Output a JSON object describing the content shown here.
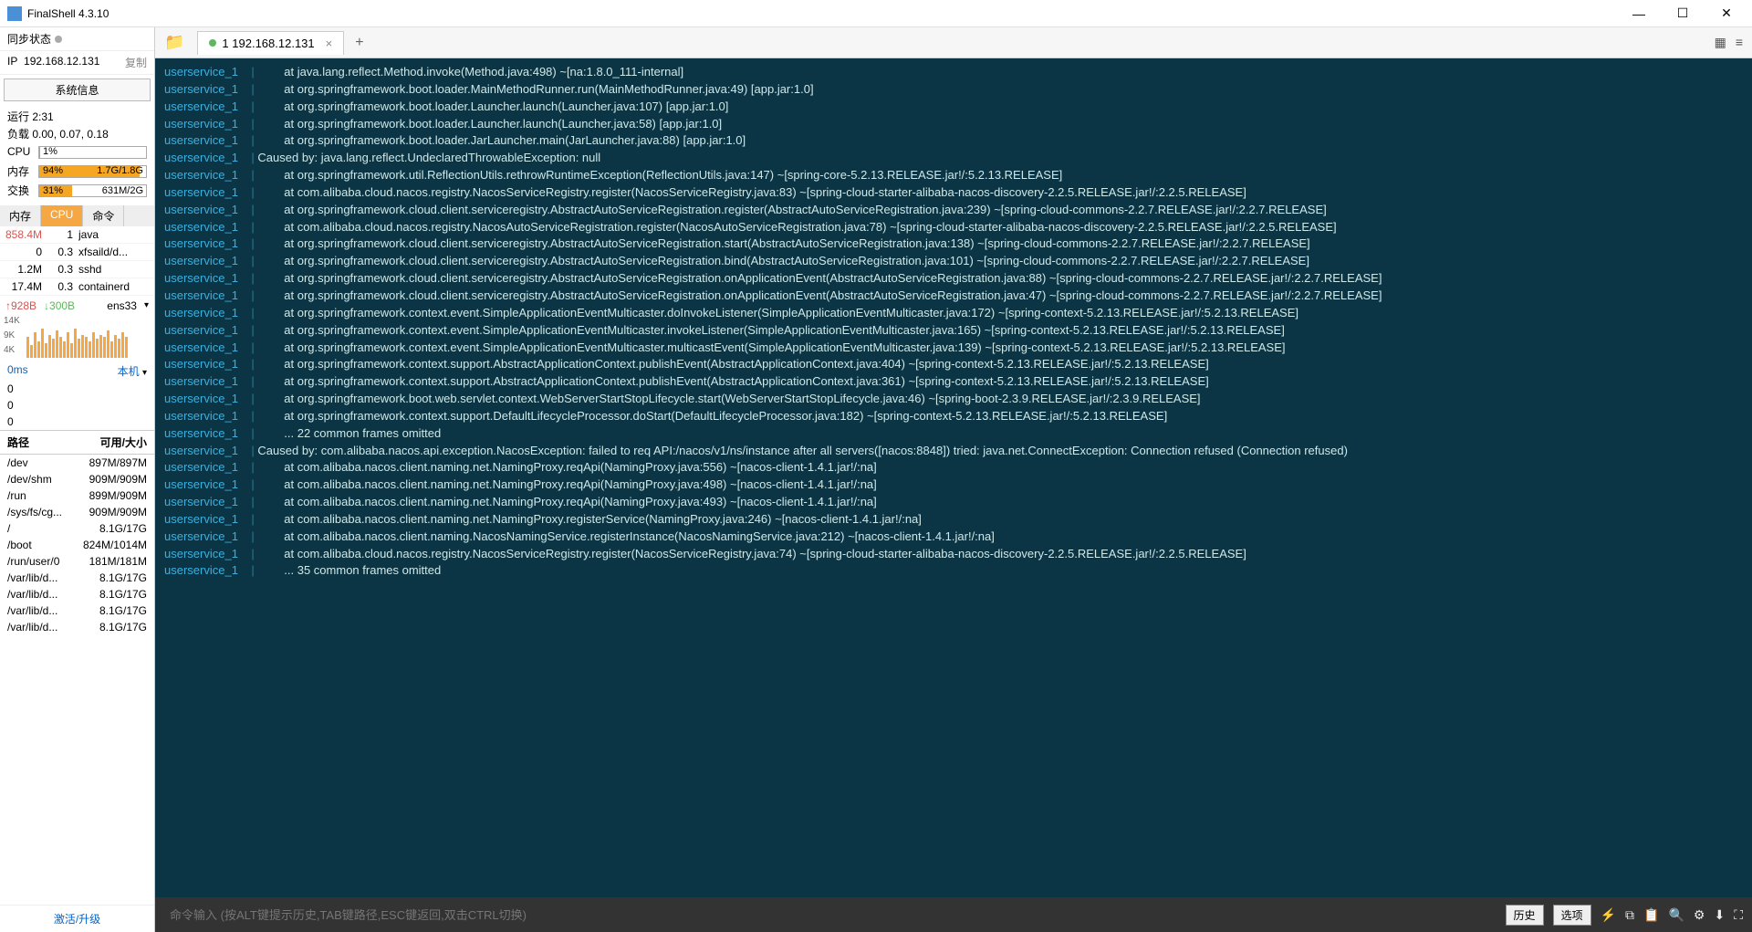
{
  "titlebar": {
    "title": "FinalShell 4.3.10"
  },
  "sidebar": {
    "sync_label": "同步状态",
    "ip_label": "IP",
    "ip_value": "192.168.12.131",
    "copy_label": "复制",
    "sysinfo_btn": "系统信息",
    "runtime": "运行 2:31",
    "load": "负载 0.00, 0.07, 0.18",
    "meters": {
      "cpu": {
        "label": "CPU",
        "pct": "1%",
        "width": "1%",
        "right": ""
      },
      "mem": {
        "label": "内存",
        "pct": "94%",
        "width": "94%",
        "right": "1.7G/1.8G"
      },
      "swap": {
        "label": "交换",
        "pct": "31%",
        "width": "31%",
        "right": "631M/2G"
      }
    },
    "proc_tabs": {
      "mem": "内存",
      "cpu": "CPU",
      "cmd": "命令"
    },
    "procs": [
      {
        "mem": "858.4M",
        "cpu": "1",
        "cmd": "java"
      },
      {
        "mem": "0",
        "cpu": "0.3",
        "cmd": "xfsaild/d..."
      },
      {
        "mem": "1.2M",
        "cpu": "0.3",
        "cmd": "sshd"
      },
      {
        "mem": "17.4M",
        "cpu": "0.3",
        "cmd": "containerd"
      }
    ],
    "net": {
      "up": "928B",
      "down": "300B",
      "iface": "ens33"
    },
    "spark_labels": [
      "14K",
      "9K",
      "4K"
    ],
    "latency": {
      "val": "0ms",
      "host": "本机",
      "a": "0",
      "b": "0",
      "c": "0"
    },
    "disk_hdr": {
      "path": "路径",
      "size": "可用/大小"
    },
    "disks": [
      {
        "path": "/dev",
        "size": "897M/897M"
      },
      {
        "path": "/dev/shm",
        "size": "909M/909M"
      },
      {
        "path": "/run",
        "size": "899M/909M"
      },
      {
        "path": "/sys/fs/cg...",
        "size": "909M/909M"
      },
      {
        "path": "/",
        "size": "8.1G/17G"
      },
      {
        "path": "/boot",
        "size": "824M/1014M"
      },
      {
        "path": "/run/user/0",
        "size": "181M/181M"
      },
      {
        "path": "/var/lib/d...",
        "size": "8.1G/17G"
      },
      {
        "path": "/var/lib/d...",
        "size": "8.1G/17G"
      },
      {
        "path": "/var/lib/d...",
        "size": "8.1G/17G"
      },
      {
        "path": "/var/lib/d...",
        "size": "8.1G/17G"
      }
    ],
    "activate": "激活/升级"
  },
  "session": {
    "tab_label": "1 192.168.12.131"
  },
  "terminal_lines": [
    {
      "svc": "userservice_1",
      "txt": "        at java.lang.reflect.Method.invoke(Method.java:498) ~[na:1.8.0_111-internal]"
    },
    {
      "svc": "userservice_1",
      "txt": "        at org.springframework.boot.loader.MainMethodRunner.run(MainMethodRunner.java:49) [app.jar:1.0]"
    },
    {
      "svc": "userservice_1",
      "txt": "        at org.springframework.boot.loader.Launcher.launch(Launcher.java:107) [app.jar:1.0]"
    },
    {
      "svc": "userservice_1",
      "txt": "        at org.springframework.boot.loader.Launcher.launch(Launcher.java:58) [app.jar:1.0]"
    },
    {
      "svc": "userservice_1",
      "txt": "        at org.springframework.boot.loader.JarLauncher.main(JarLauncher.java:88) [app.jar:1.0]"
    },
    {
      "svc": "userservice_1",
      "txt": "Caused by: java.lang.reflect.UndeclaredThrowableException: null"
    },
    {
      "svc": "userservice_1",
      "txt": "        at org.springframework.util.ReflectionUtils.rethrowRuntimeException(ReflectionUtils.java:147) ~[spring-core-5.2.13.RELEASE.jar!/:5.2.13.RELEASE]"
    },
    {
      "svc": "userservice_1",
      "txt": "        at com.alibaba.cloud.nacos.registry.NacosServiceRegistry.register(NacosServiceRegistry.java:83) ~[spring-cloud-starter-alibaba-nacos-discovery-2.2.5.RELEASE.jar!/:2.2.5.RELEASE]"
    },
    {
      "svc": "userservice_1",
      "txt": "        at org.springframework.cloud.client.serviceregistry.AbstractAutoServiceRegistration.register(AbstractAutoServiceRegistration.java:239) ~[spring-cloud-commons-2.2.7.RELEASE.jar!/:2.2.7.RELEASE]"
    },
    {
      "svc": "userservice_1",
      "txt": "        at com.alibaba.cloud.nacos.registry.NacosAutoServiceRegistration.register(NacosAutoServiceRegistration.java:78) ~[spring-cloud-starter-alibaba-nacos-discovery-2.2.5.RELEASE.jar!/:2.2.5.RELEASE]"
    },
    {
      "svc": "userservice_1",
      "txt": "        at org.springframework.cloud.client.serviceregistry.AbstractAutoServiceRegistration.start(AbstractAutoServiceRegistration.java:138) ~[spring-cloud-commons-2.2.7.RELEASE.jar!/:2.2.7.RELEASE]"
    },
    {
      "svc": "userservice_1",
      "txt": "        at org.springframework.cloud.client.serviceregistry.AbstractAutoServiceRegistration.bind(AbstractAutoServiceRegistration.java:101) ~[spring-cloud-commons-2.2.7.RELEASE.jar!/:2.2.7.RELEASE]"
    },
    {
      "svc": "userservice_1",
      "txt": "        at org.springframework.cloud.client.serviceregistry.AbstractAutoServiceRegistration.onApplicationEvent(AbstractAutoServiceRegistration.java:88) ~[spring-cloud-commons-2.2.7.RELEASE.jar!/:2.2.7.RELEASE]"
    },
    {
      "svc": "userservice_1",
      "txt": "        at org.springframework.cloud.client.serviceregistry.AbstractAutoServiceRegistration.onApplicationEvent(AbstractAutoServiceRegistration.java:47) ~[spring-cloud-commons-2.2.7.RELEASE.jar!/:2.2.7.RELEASE]"
    },
    {
      "svc": "userservice_1",
      "txt": "        at org.springframework.context.event.SimpleApplicationEventMulticaster.doInvokeListener(SimpleApplicationEventMulticaster.java:172) ~[spring-context-5.2.13.RELEASE.jar!/:5.2.13.RELEASE]"
    },
    {
      "svc": "userservice_1",
      "txt": "        at org.springframework.context.event.SimpleApplicationEventMulticaster.invokeListener(SimpleApplicationEventMulticaster.java:165) ~[spring-context-5.2.13.RELEASE.jar!/:5.2.13.RELEASE]"
    },
    {
      "svc": "userservice_1",
      "txt": "        at org.springframework.context.event.SimpleApplicationEventMulticaster.multicastEvent(SimpleApplicationEventMulticaster.java:139) ~[spring-context-5.2.13.RELEASE.jar!/:5.2.13.RELEASE]"
    },
    {
      "svc": "userservice_1",
      "txt": "        at org.springframework.context.support.AbstractApplicationContext.publishEvent(AbstractApplicationContext.java:404) ~[spring-context-5.2.13.RELEASE.jar!/:5.2.13.RELEASE]"
    },
    {
      "svc": "userservice_1",
      "txt": "        at org.springframework.context.support.AbstractApplicationContext.publishEvent(AbstractApplicationContext.java:361) ~[spring-context-5.2.13.RELEASE.jar!/:5.2.13.RELEASE]"
    },
    {
      "svc": "userservice_1",
      "txt": "        at org.springframework.boot.web.servlet.context.WebServerStartStopLifecycle.start(WebServerStartStopLifecycle.java:46) ~[spring-boot-2.3.9.RELEASE.jar!/:2.3.9.RELEASE]"
    },
    {
      "svc": "userservice_1",
      "txt": "        at org.springframework.context.support.DefaultLifecycleProcessor.doStart(DefaultLifecycleProcessor.java:182) ~[spring-context-5.2.13.RELEASE.jar!/:5.2.13.RELEASE]"
    },
    {
      "svc": "userservice_1",
      "txt": "        ... 22 common frames omitted"
    },
    {
      "svc": "userservice_1",
      "txt": "Caused by: com.alibaba.nacos.api.exception.NacosException: failed to req API:/nacos/v1/ns/instance after all servers([nacos:8848]) tried: java.net.ConnectException: Connection refused (Connection refused)"
    },
    {
      "svc": "userservice_1",
      "txt": "        at com.alibaba.nacos.client.naming.net.NamingProxy.reqApi(NamingProxy.java:556) ~[nacos-client-1.4.1.jar!/:na]"
    },
    {
      "svc": "userservice_1",
      "txt": "        at com.alibaba.nacos.client.naming.net.NamingProxy.reqApi(NamingProxy.java:498) ~[nacos-client-1.4.1.jar!/:na]"
    },
    {
      "svc": "userservice_1",
      "txt": "        at com.alibaba.nacos.client.naming.net.NamingProxy.reqApi(NamingProxy.java:493) ~[nacos-client-1.4.1.jar!/:na]"
    },
    {
      "svc": "userservice_1",
      "txt": "        at com.alibaba.nacos.client.naming.net.NamingProxy.registerService(NamingProxy.java:246) ~[nacos-client-1.4.1.jar!/:na]"
    },
    {
      "svc": "userservice_1",
      "txt": "        at com.alibaba.nacos.client.naming.NacosNamingService.registerInstance(NacosNamingService.java:212) ~[nacos-client-1.4.1.jar!/:na]"
    },
    {
      "svc": "userservice_1",
      "txt": "        at com.alibaba.cloud.nacos.registry.NacosServiceRegistry.register(NacosServiceRegistry.java:74) ~[spring-cloud-starter-alibaba-nacos-discovery-2.2.5.RELEASE.jar!/:2.2.5.RELEASE]"
    },
    {
      "svc": "userservice_1",
      "txt": "        ... 35 common frames omitted"
    }
  ],
  "cmdbar": {
    "placeholder": "命令输入 (按ALT键提示历史,TAB键路径,ESC键返回,双击CTRL切换)",
    "history": "历史",
    "options": "选项"
  }
}
